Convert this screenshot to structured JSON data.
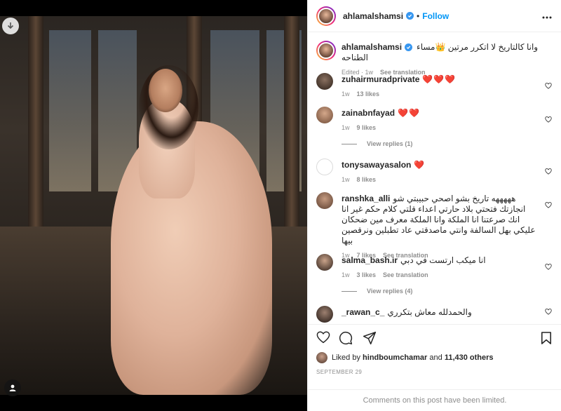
{
  "post": {
    "username": "ahlamalshamsi",
    "follow_label": "Follow",
    "separator": "•",
    "caption": "وانا كالتاريخ لا اتكرر مرتين 👑مساء الطناحه",
    "caption_meta": {
      "edited": "Edited · 1w",
      "translate": "See translation"
    }
  },
  "comments": [
    {
      "user": "zuhairmuradprivate",
      "text": "❤️❤️❤️",
      "time": "1w",
      "likes": "13 likes",
      "translate": ""
    },
    {
      "user": "zainabnfayad",
      "text": "❤️❤️",
      "time": "1w",
      "likes": "9 likes",
      "translate": "",
      "replies": "View replies (1)"
    },
    {
      "user": "tonysawayasalon",
      "text": "❤️",
      "time": "1w",
      "likes": "8 likes",
      "translate": ""
    },
    {
      "user": "ranshka_alli",
      "text": "هههههه تاريخ بشو اصحي حبيبتي شو انجازتك فتحتي بلاد حارتي اعداء قلتي كلام حكم غير انا انك صرعتنا انا الملكة وانا الملكة معرف مين ضحكان عليكي بهل السالفة وانتي ماصدقتي عاد تطبلين ونرقصين بيها",
      "time": "1w",
      "likes": "7 likes",
      "translate": "See translation"
    },
    {
      "user": "salma_bash.ir",
      "text": "انا ميكب ارتست في دبي",
      "time": "1w",
      "likes": "3 likes",
      "translate": "See translation",
      "replies": "View replies (4)"
    },
    {
      "user": "_rawan_c_",
      "text": "والحمدلله معاش بتكرري",
      "time": "",
      "likes": "",
      "translate": ""
    }
  ],
  "likes": {
    "prefix": "Liked by",
    "user": "hindboumchamar",
    "and": "and",
    "others": "11,430 others"
  },
  "date": "SEPTEMBER 29",
  "limited_text": "Comments on this post have been limited.",
  "icons": [
    "download-icon",
    "tag-user-icon",
    "verified-icon",
    "more-icon",
    "heart-icon",
    "comment-icon",
    "share-icon",
    "bookmark-icon"
  ],
  "colors": {
    "accent": "#0095f6",
    "verified": "#3897f0",
    "heart": "#ed4956",
    "muted": "#8e8e8e"
  }
}
